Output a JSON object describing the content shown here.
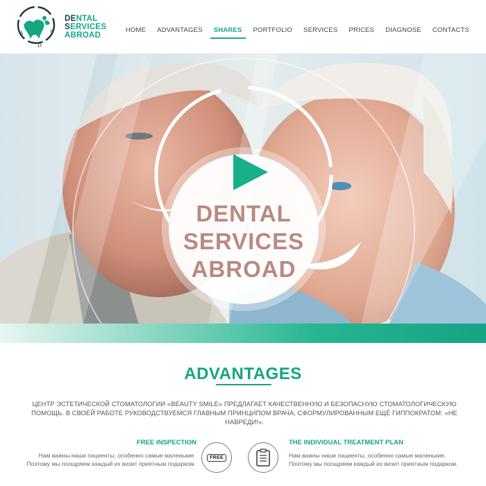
{
  "brand": {
    "line1_a": "DE",
    "line1_b": "NTAL",
    "line2_a": "S",
    "line2_b": "ERVICES",
    "line3": "ABROAD",
    "logo_letters": [
      "D",
      "S",
      "A"
    ]
  },
  "nav": {
    "items": [
      {
        "label": "HOME"
      },
      {
        "label": "ADVANTAGES"
      },
      {
        "label": "SHARES"
      },
      {
        "label": "PORTFOLIO"
      },
      {
        "label": "SERVICES"
      },
      {
        "label": "PRICES"
      },
      {
        "label": "DIAGNOSE"
      },
      {
        "label": "CONTACTS"
      }
    ],
    "active": "SHARES"
  },
  "hero": {
    "video_lines": [
      "DENTAL",
      "SERVICES",
      "ABROAD"
    ],
    "play_icon": "play-icon"
  },
  "advantages": {
    "title": "ADVANTAGES",
    "text": "ЦЕНТР ЭСТЕТИЧЕСКОЙ СТОМАТОЛОГИИ «BEAUTY SMILE» ПРЕДЛАГАЕТ КАЧЕСТВЕННУЮ И БЕЗОПАСНУЮ СТОМАТОЛОГИЧЕСКУЮ ПОМОЩЬ. В СВОЕЙ РАБОТЕ РУКОВОДСТВУЕМСЯ ГЛАВНЫМ ПРИНЦИПОМ ВРАЧА, СФОРМУЛИРОВАННЫМ ЕЩЁ ГИППОКРАТОМ: «НЕ НАВРЕДИ!».",
    "features": [
      {
        "title": "FREE INSPECTION",
        "desc": "Нам важны наши пациенты, особенно самые маленькие. Поэтому мы поощряем каждый их визит приятным подарком.",
        "icon_label": "FREE",
        "icon": "free-badge-icon"
      },
      {
        "title": "THE INDIVIDUAL TREATMENT PLAN",
        "desc": "Нам важны наши пациенты, особенно самые маленькие. Поэтому мы поощряем каждый их визит приятным подарком.",
        "icon": "clipboard-icon"
      }
    ]
  },
  "colors": {
    "accent": "#13a584",
    "brand_dark": "#1d3b4c",
    "video_text": "#b88a82"
  }
}
